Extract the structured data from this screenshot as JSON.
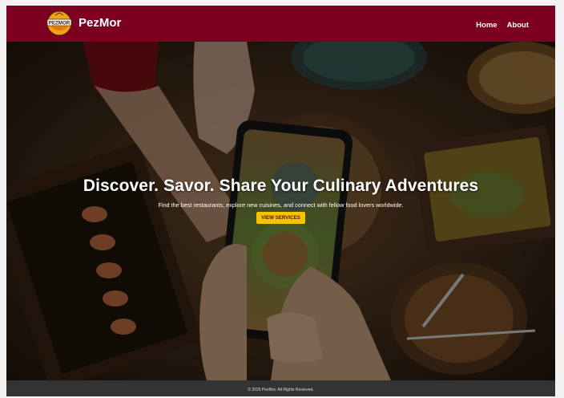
{
  "header": {
    "logo_text": "PEZMOR",
    "brand": "PezMor",
    "nav": [
      {
        "label": "Home"
      },
      {
        "label": "About"
      }
    ]
  },
  "hero": {
    "title": "Discover. Savor. Share Your Culinary Adventures",
    "subtitle": "Find the best restaurants, explore new cuisines, and connect with fellow food lovers worldwide.",
    "cta_label": "VIEW SERVICES"
  },
  "footer": {
    "copyright": "© 2025 PezMor. All Rights Reserved."
  },
  "colors": {
    "header_bg": "#7d0020",
    "cta_bg": "#f5c400",
    "footer_bg": "#333333"
  }
}
